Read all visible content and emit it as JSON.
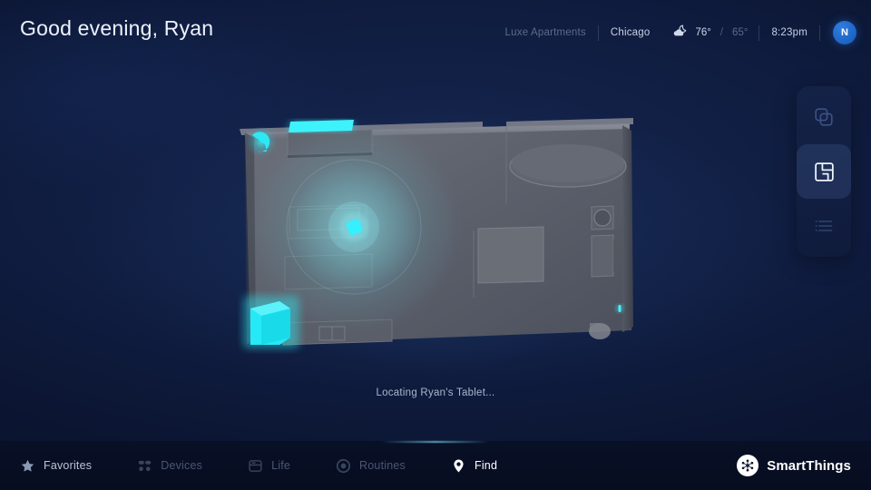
{
  "header": {
    "greeting": "Good evening, Ryan",
    "location_name": "Luxe Apartments",
    "city": "Chicago",
    "weather_icon": "cloud-moon-icon",
    "temp_high": "76°",
    "temp_separator": "/",
    "temp_low": "65°",
    "time": "8:23pm",
    "avatar_initial": "N"
  },
  "rail": {
    "buttons": [
      {
        "name": "layers-icon",
        "label": "Layers",
        "active": false
      },
      {
        "name": "floorplan-icon",
        "label": "Floor plan",
        "active": true
      },
      {
        "name": "list-icon",
        "label": "Device list",
        "active": false
      }
    ]
  },
  "map": {
    "status_text": "Locating Ryan's Tablet...",
    "tracked_device": "Ryan's Tablet",
    "markers": [
      {
        "name": "cyan-cube-device",
        "type": "cube"
      },
      {
        "name": "cyan-light-strip",
        "type": "strip"
      },
      {
        "name": "cyan-blob-device",
        "type": "blob"
      },
      {
        "name": "tablet-marker",
        "type": "tablet"
      },
      {
        "name": "wall-sensor-dot",
        "type": "dot"
      }
    ],
    "colors": {
      "accent": "#2ee8f2",
      "floor": "#5a5e68",
      "background": "#101d41"
    }
  },
  "nav": {
    "items": [
      {
        "label": "Favorites",
        "icon": "star-icon",
        "state": "dim-bright"
      },
      {
        "label": "Devices",
        "icon": "devices-icon",
        "state": "dim"
      },
      {
        "label": "Life",
        "icon": "life-icon",
        "state": "dim"
      },
      {
        "label": "Routines",
        "icon": "routines-icon",
        "state": "dim"
      },
      {
        "label": "Find",
        "icon": "find-pin-icon",
        "state": "active"
      }
    ],
    "brand": {
      "name": "SmartThings",
      "icon": "smartthings-logo-icon"
    }
  }
}
